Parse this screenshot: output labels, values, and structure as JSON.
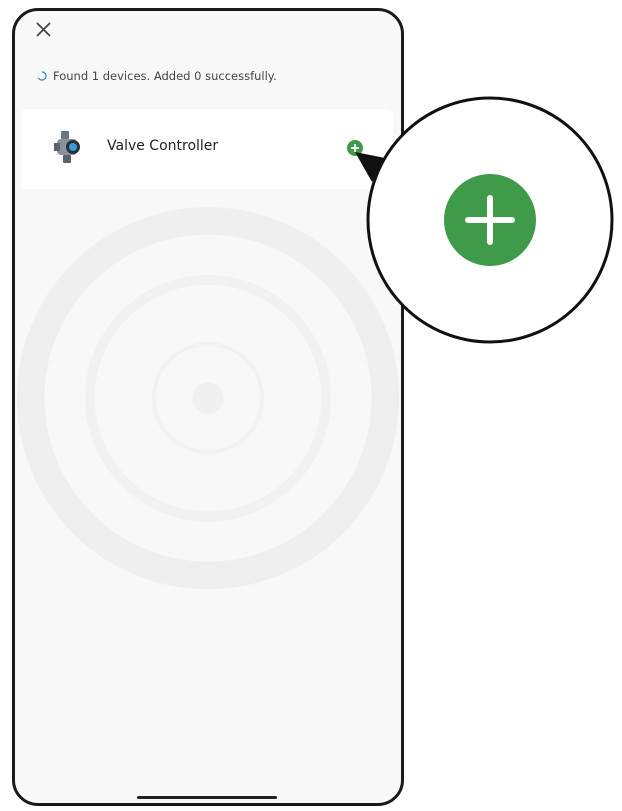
{
  "status": {
    "text": "Found 1 devices. Added 0 successfully."
  },
  "device": {
    "name": "Valve Controller"
  },
  "icons": {
    "close": "close-icon",
    "spinner": "loading-spinner-icon",
    "device": "valve-icon",
    "add": "plus-icon"
  },
  "colors": {
    "accent_green": "#3f9a4a",
    "spinner_blue": "#3d8fd6"
  }
}
